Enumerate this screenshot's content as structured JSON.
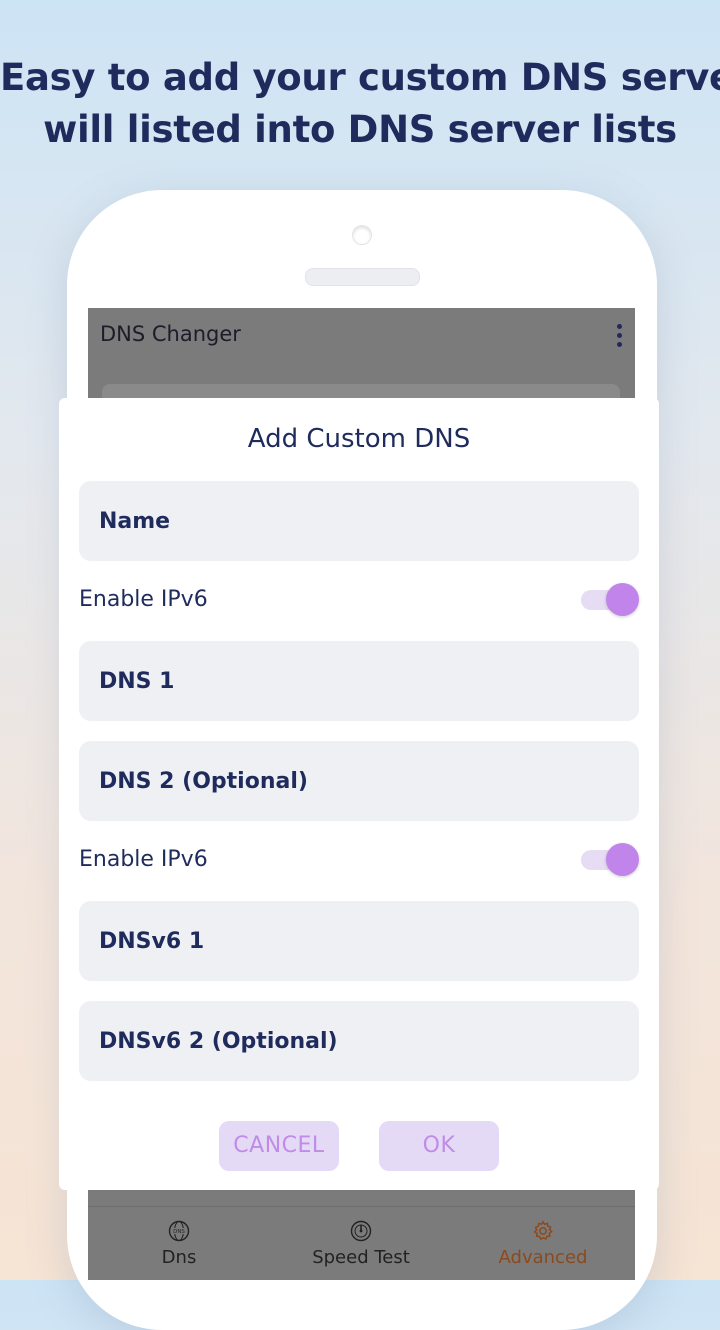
{
  "promo": {
    "headline_line1": "Easy to add your custom DNS server",
    "headline_line2": "will listed into DNS server lists"
  },
  "appbar": {
    "title": "DNS Changer",
    "menu_icon": "more-vert-icon"
  },
  "dialog": {
    "title": "Add Custom DNS",
    "name_placeholder": "Name",
    "ipv6_toggle_1": {
      "label": "Enable IPv6",
      "on": true
    },
    "dns1_placeholder": "DNS 1",
    "dns2_placeholder": "DNS 2 (Optional)",
    "ipv6_toggle_2": {
      "label": "Enable IPv6",
      "on": true
    },
    "dnsv6_1_placeholder": "DNSv6 1",
    "dnsv6_2_placeholder": "DNSv6 2 (Optional)",
    "cancel_label": "CANCEL",
    "ok_label": "OK"
  },
  "bottom_nav": {
    "items": [
      {
        "label": "Dns",
        "icon": "dns-globe-icon",
        "active": false
      },
      {
        "label": "Speed Test",
        "icon": "speedometer-icon",
        "active": false
      },
      {
        "label": "Advanced",
        "icon": "gear-icon",
        "active": true
      }
    ]
  },
  "colors": {
    "primary_text": "#1f2b5c",
    "accent": "#c084ea",
    "button_bg": "#e5daf5",
    "active_tab": "#8b4a1e"
  }
}
